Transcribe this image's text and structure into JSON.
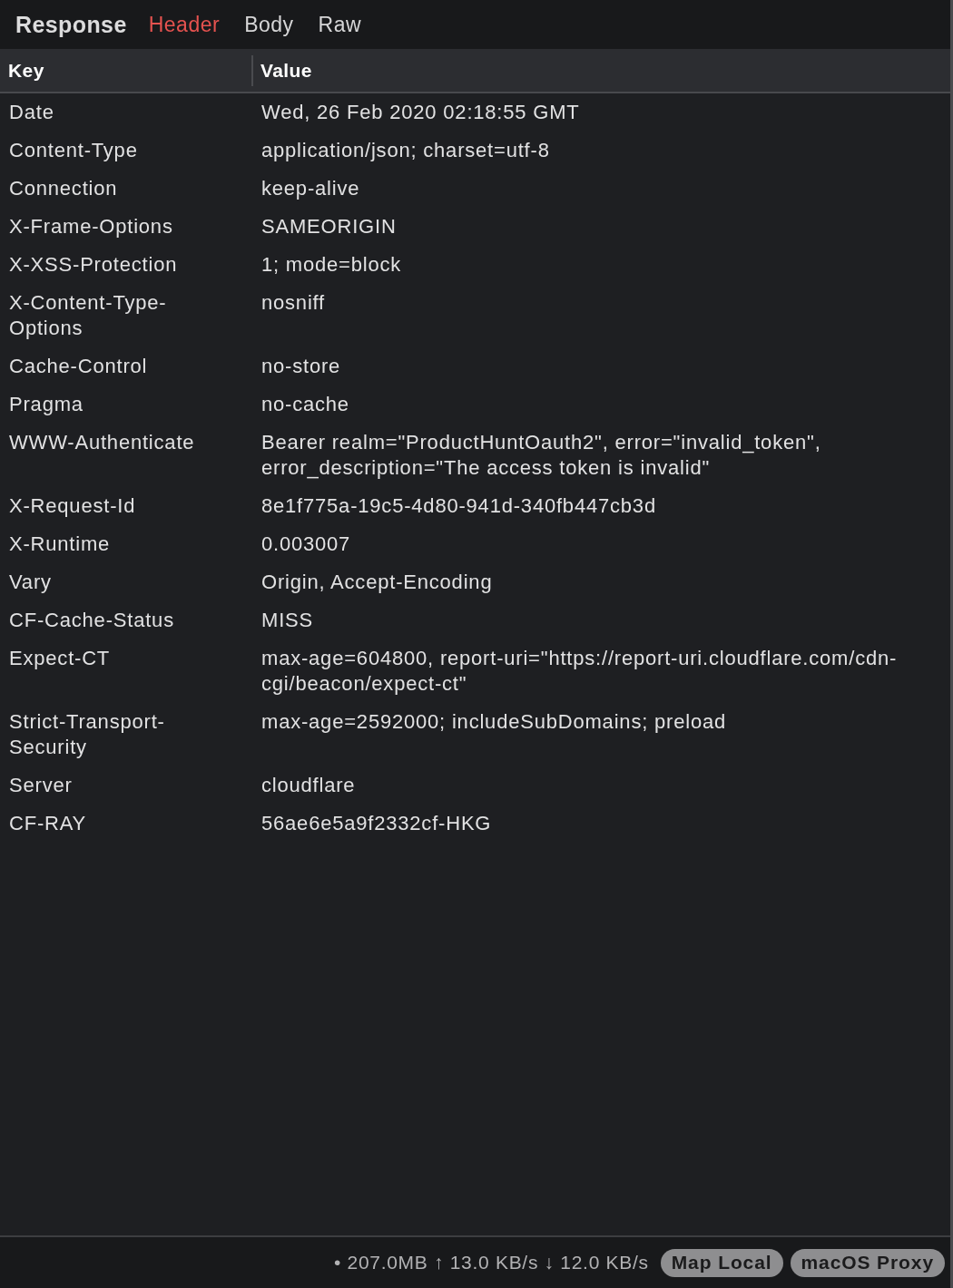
{
  "panel": {
    "title": "Response",
    "tabs": [
      {
        "label": "Header",
        "selected": true
      },
      {
        "label": "Body",
        "selected": false
      },
      {
        "label": "Raw",
        "selected": false
      }
    ]
  },
  "table": {
    "columns": [
      "Key",
      "Value"
    ],
    "rows": [
      {
        "key": "Date",
        "value": "Wed, 26 Feb 2020 02:18:55 GMT"
      },
      {
        "key": "Content-Type",
        "value": "application/json; charset=utf-8"
      },
      {
        "key": "Connection",
        "value": "keep-alive"
      },
      {
        "key": "X-Frame-Options",
        "value": "SAMEORIGIN"
      },
      {
        "key": "X-XSS-Protection",
        "value": "1; mode=block"
      },
      {
        "key": "X-Content-Type-Options",
        "value": "nosniff"
      },
      {
        "key": "Cache-Control",
        "value": "no-store"
      },
      {
        "key": "Pragma",
        "value": "no-cache"
      },
      {
        "key": "WWW-Authenticate",
        "value": "Bearer realm=\"ProductHuntOauth2\", error=\"invalid_token\", error_description=\"The access token is invalid\""
      },
      {
        "key": "X-Request-Id",
        "value": "8e1f775a-19c5-4d80-941d-340fb447cb3d"
      },
      {
        "key": "X-Runtime",
        "value": "0.003007"
      },
      {
        "key": "Vary",
        "value": "Origin, Accept-Encoding"
      },
      {
        "key": "CF-Cache-Status",
        "value": "MISS"
      },
      {
        "key": "Expect-CT",
        "value": "max-age=604800, report-uri=\"https://report-uri.cloudflare.com/cdn-cgi/beacon/expect-ct\""
      },
      {
        "key": "Strict-Transport-Security",
        "value": "max-age=2592000; includeSubDomains; preload"
      },
      {
        "key": "Server",
        "value": "cloudflare"
      },
      {
        "key": "CF-RAY",
        "value": "56ae6e5a9f2332cf-HKG"
      }
    ]
  },
  "status_bar": {
    "stats": "• 207.0MB ↑ 13.0 KB/s ↓ 12.0 KB/s",
    "buttons": [
      "Map Local",
      "macOS Proxy"
    ]
  }
}
